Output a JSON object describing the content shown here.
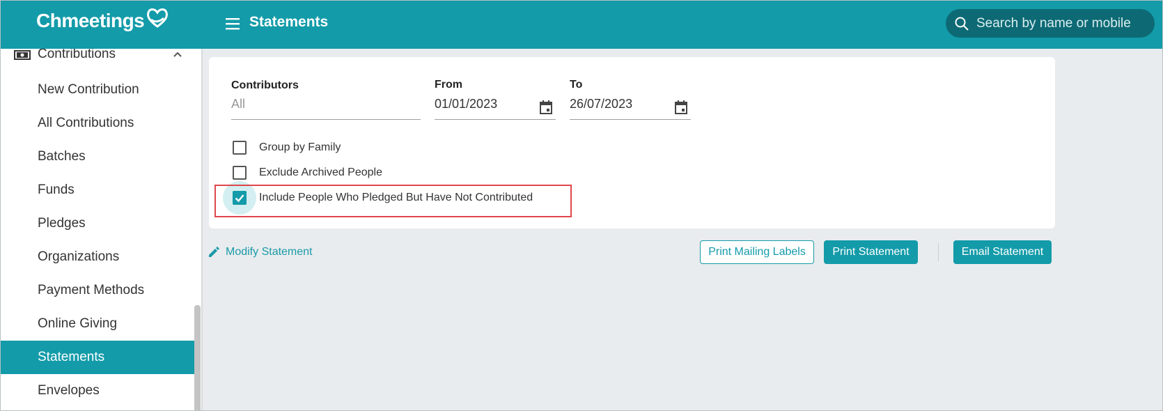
{
  "header": {
    "brand": "Chmeetings",
    "page_title": "Statements",
    "menu_icon": "hamburger-icon",
    "search": {
      "placeholder": "Search by name or mobile",
      "icon": "search-icon"
    }
  },
  "sidebar": {
    "section": {
      "label": "Contributions",
      "icon": "money-icon",
      "chevron": "chevron-up-icon"
    },
    "items": [
      {
        "label": "New Contribution",
        "active": false
      },
      {
        "label": "All Contributions",
        "active": false
      },
      {
        "label": "Batches",
        "active": false
      },
      {
        "label": "Funds",
        "active": false
      },
      {
        "label": "Pledges",
        "active": false
      },
      {
        "label": "Organizations",
        "active": false
      },
      {
        "label": "Payment Methods",
        "active": false
      },
      {
        "label": "Online Giving",
        "active": false
      },
      {
        "label": "Statements",
        "active": true
      },
      {
        "label": "Envelopes",
        "active": false
      }
    ]
  },
  "form": {
    "contributors": {
      "label": "Contributors",
      "value": "All"
    },
    "from": {
      "label": "From",
      "value": "01/01/2023"
    },
    "to": {
      "label": "To",
      "value": "26/07/2023"
    },
    "options": [
      {
        "label": "Group by Family",
        "checked": false
      },
      {
        "label": "Exclude Archived People",
        "checked": false
      },
      {
        "label": "Include People Who Pledged But Have Not Contributed",
        "checked": true
      }
    ]
  },
  "actions": {
    "modify": "Modify Statement",
    "print_labels": "Print Mailing Labels",
    "print_statement": "Print Statement",
    "email_statement": "Email Statement"
  },
  "colors": {
    "brand": "#139ba9",
    "search_bg": "#0d6a75",
    "highlight": "#e0464b",
    "page_bg": "#e9ecee"
  }
}
